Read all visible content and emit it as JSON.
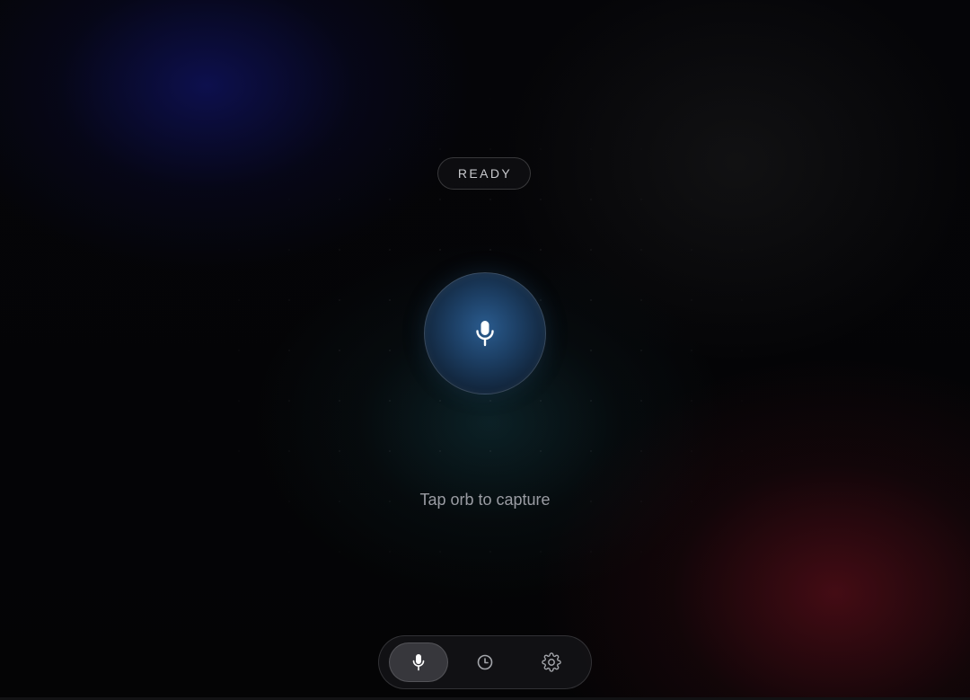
{
  "status": {
    "label": "READY"
  },
  "orb": {
    "icon": "microphone-icon",
    "accent": "#2a5b8e"
  },
  "hint": {
    "text": "Tap orb to capture"
  },
  "dock": {
    "items": [
      {
        "icon": "microphone-icon",
        "active": true
      },
      {
        "icon": "clock-icon",
        "active": false
      },
      {
        "icon": "gear-icon",
        "active": false
      }
    ]
  },
  "colors": {
    "background": "#050507",
    "blue_glow": "#12167a",
    "red_glow": "#781220",
    "teal_glow": "#164852"
  }
}
